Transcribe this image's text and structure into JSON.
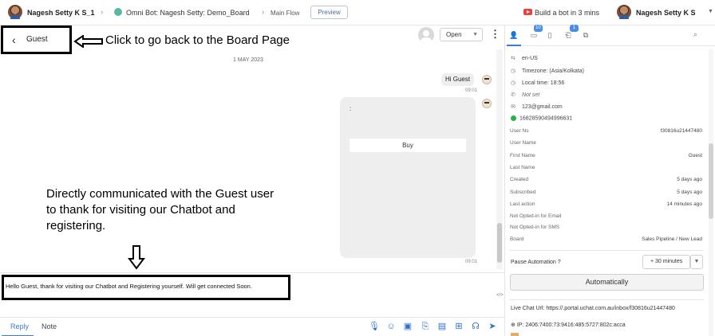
{
  "topbar": {
    "user_name": "Nagesh Setty K S_1",
    "bot_path": "Omni Bot: Nagesh Setty: Demo_Board",
    "flow": "Main Flow",
    "preview_label": "Preview",
    "promo": "Build a bot in 3 mins",
    "account_name": "Nagesh Setty K S"
  },
  "chat": {
    "contact_name": "Guest",
    "status": "Open",
    "date": "1 MAY 2023",
    "messages": [
      {
        "text": "Hi Guest",
        "time": "09:01"
      },
      {
        "text": ":",
        "button": "Buy",
        "time": "09:01"
      }
    ],
    "composer_text": "Hello Guest, thank for visiting our Chatbot and Registering yourself. Will get connected Soon.",
    "code_icon_text": "</>",
    "tabs": {
      "reply": "Reply",
      "note": "Note"
    }
  },
  "annotations": {
    "back": "Click to go back to the Board Page",
    "info": "Directly communicated with the Guest user to thank for visiting our Chatbot and registering."
  },
  "panel": {
    "badges": {
      "messages": "10",
      "notes": "1"
    },
    "locale": "en-US",
    "timezone": "Timezone: (Asia/Kolkata)",
    "local_time": "Local time: 18:56",
    "phone": "Not set",
    "email": "123@gmail.com",
    "whatsapp": "16828590494996631",
    "fields": [
      {
        "label": "User Ns",
        "value": "f30816u21447480"
      },
      {
        "label": "User Name",
        "value": ""
      },
      {
        "label": "First Name",
        "value": "Guest"
      },
      {
        "label": "Last Name",
        "value": ""
      },
      {
        "label": "Created",
        "value": "5 days ago"
      },
      {
        "label": "Subscribed",
        "value": "5 days ago"
      },
      {
        "label": "Last action",
        "value": "14 minutes ago"
      },
      {
        "label": "Not Opted-in for Email",
        "value": ""
      },
      {
        "label": "Not Opted-in for SMS",
        "value": ""
      },
      {
        "label": "Board",
        "value": "Sales Pipeline / New Lead"
      }
    ],
    "pause_label": "Pause Automation",
    "pause_value": "+ 30 minutes",
    "automatic_label": "Automatically",
    "live_chat_url": "Live Chat Url:  https://.portal.uchat.com.au/inbox/f30816u21447480",
    "ip": "IP: 2406:7400:73:9416:485:5727:802c:acca"
  },
  "colors": {
    "accent": "#3d7bd6",
    "badge": "#4a8ee8",
    "youtube": "#e8423f",
    "whatsapp": "#27b14b"
  }
}
